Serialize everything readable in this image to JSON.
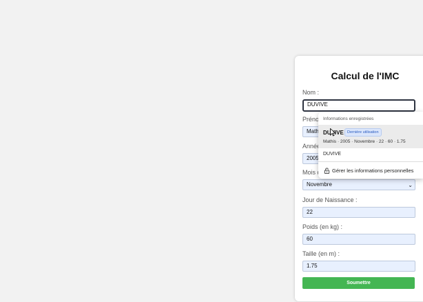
{
  "form": {
    "title": "Calcul de l'IMC",
    "nom_label": "Nom :",
    "nom_value": "DUVIVE",
    "prenom_label": "Prénom :",
    "prenom_value": "Mathis",
    "annee_label": "Année de Naissance :",
    "annee_value": "2005",
    "mois_label": "Mois de Naissance :",
    "mois_value": "Novembre",
    "jour_label": "Jour de Naissance :",
    "jour_value": "22",
    "poids_label": "Poids (en kg) :",
    "poids_value": "60",
    "taille_label": "Taille (en m) :",
    "taille_value": "1.75",
    "submit_label": "Soumettre"
  },
  "autofill": {
    "header": "Informations enregistrées",
    "item1_name": "DUVIVE",
    "item1_badge": "Dernière utilisation",
    "item1_detail": "Mathis · 2005 · Novembre · 22 · 60 · 1.75",
    "item2_name": "DUVIVE",
    "manage_label": "Gérer les informations personnelles"
  },
  "colors": {
    "submit": "#44b653",
    "autofill_bg": "#e8f0fe"
  }
}
